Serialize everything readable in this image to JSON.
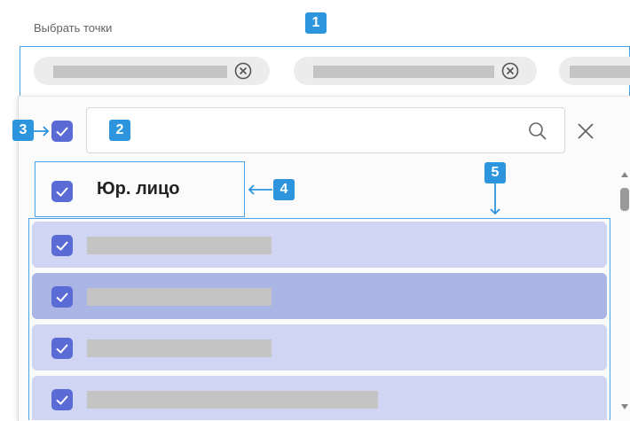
{
  "field": {
    "label": "Выбрать точки"
  },
  "selected_chips": [
    {
      "icon": "remove-circle-icon"
    },
    {
      "icon": "remove-circle-icon"
    },
    {
      "icon": "remove-circle-icon"
    }
  ],
  "search": {
    "value": "",
    "placeholder": "",
    "icon": "search-icon",
    "clear_icon": "close-icon"
  },
  "group": {
    "title": "Юр. лицо",
    "checked": true
  },
  "select_all": {
    "checked": true
  },
  "items": [
    {
      "checked": true,
      "selected": false
    },
    {
      "checked": true,
      "selected": true
    },
    {
      "checked": true,
      "selected": false
    },
    {
      "checked": true,
      "selected": false
    }
  ],
  "annotations": [
    "1",
    "2",
    "3",
    "4",
    "5"
  ],
  "colors": {
    "accent": "#5b6bd6",
    "row": "#cfd5f2",
    "row_selected": "#aab5e6",
    "annotation": "#2c95de"
  }
}
